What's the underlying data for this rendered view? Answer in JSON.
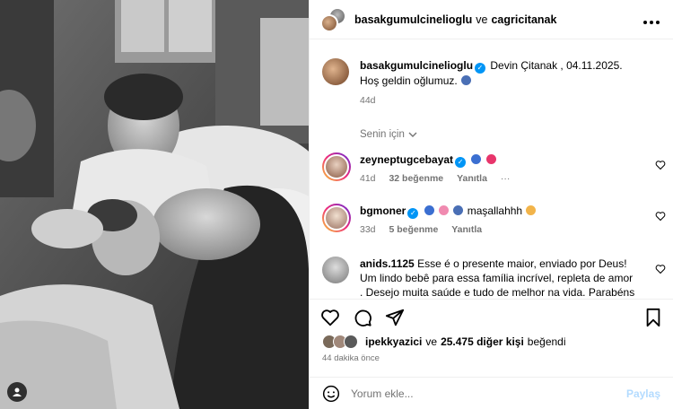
{
  "header": {
    "user1": "basakgumulcinelioglu",
    "conj": "ve",
    "user2": "cagricitanak",
    "more_icon": "more-horizontal-icon"
  },
  "caption": {
    "username": "basakgumulcinelioglu",
    "text_line1": "Devin Çitanak , 04.11.2025.",
    "text_line2": "Hoş geldin oğlumuz.",
    "age": "44d"
  },
  "for_you": "Senin için",
  "comments": [
    {
      "username": "zeynep­tugcebayat",
      "age": "41d",
      "likes": "32 beğenme",
      "reply": "Yanıtla"
    },
    {
      "username": "bgmoner",
      "text": "maşallahhh",
      "age": "33d",
      "likes": "5 beğenme",
      "reply": "Yanıtla"
    },
    {
      "username": "anids.1125",
      "text": "Esse é o presente maior, enviado por Deus! Um lindo bebê para essa família incrível, repleta de amor . Desejo muita saúde e tudo de melhor na vida. Parabéns mamãe e papai ! Lindos"
    }
  ],
  "likes_line": {
    "user": "ipekkyazici",
    "conj": "ve",
    "others": "25.475 diğer kişi",
    "suffix": "beğendi"
  },
  "time_ago": "44 dakika önce",
  "compose": {
    "placeholder": "Yorum ekle...",
    "post_label": "Paylaş"
  },
  "colors": {
    "verified": "#0095f6",
    "muted": "#737373",
    "divider": "#efefef",
    "post_disabled": "#b3dbff"
  }
}
